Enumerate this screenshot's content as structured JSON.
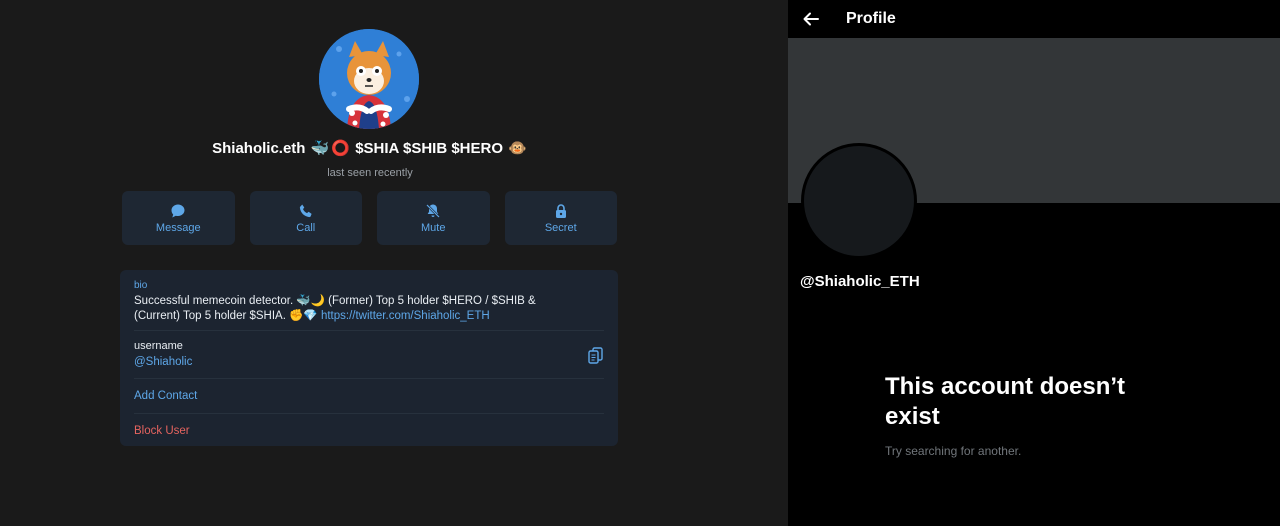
{
  "telegram": {
    "name_prefix": "Shiaholic.eth",
    "name_emojis": [
      "🐳",
      "⭕"
    ],
    "name_suffix": "$SHIA $SHIB $HERO",
    "name_end_emoji": "🐵",
    "status": "last seen recently",
    "actions": [
      {
        "label": "Message",
        "icon": "chat-bubble-icon"
      },
      {
        "label": "Call",
        "icon": "phone-icon"
      },
      {
        "label": "Mute",
        "icon": "bell-slash-icon"
      },
      {
        "label": "Secret",
        "icon": "lock-icon"
      }
    ],
    "bio_label": "bio",
    "bio_text_1": "Successful memecoin detector. 🐳🌙 (Former) Top 5 holder $HERO / $SHIB &",
    "bio_text_2": "(Current) Top 5 holder $SHIA. ✊💎",
    "bio_link": "https://twitter.com/Shiaholic_ETH",
    "username_label": "username",
    "username_value": "@Shiaholic",
    "add_contact": "Add Contact",
    "block_user": "Block User",
    "accent": "#5ea7e8",
    "danger": "#e5645f"
  },
  "twitter": {
    "header_title": "Profile",
    "handle": "@Shiaholic_ETH",
    "empty_title": "This account doesn’t exist",
    "empty_subtitle": "Try searching for another."
  }
}
